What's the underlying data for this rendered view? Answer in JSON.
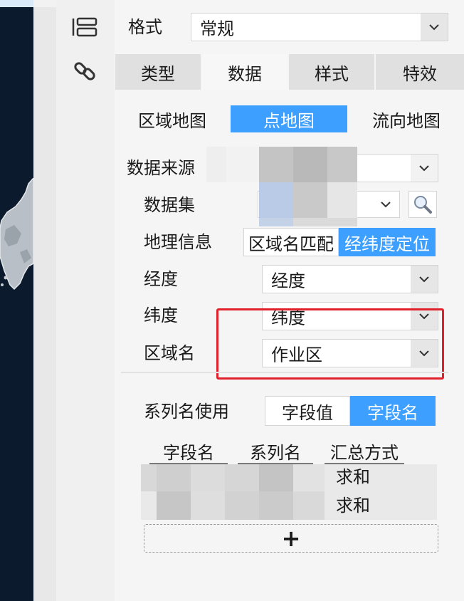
{
  "colors": {
    "accent": "#3d9fff",
    "highlight_box": "#e0212b",
    "map_bg": "#0b1a2c",
    "panel_bg": "#f5f5f5"
  },
  "rail": {
    "icons": [
      "layout-icon",
      "link-icon"
    ]
  },
  "format": {
    "label": "格式",
    "value": "常规"
  },
  "tabs": [
    {
      "label": "类型",
      "active": false
    },
    {
      "label": "数据",
      "active": true
    },
    {
      "label": "样式",
      "active": false
    },
    {
      "label": "特效",
      "active": false
    }
  ],
  "map_types": [
    {
      "label": "区域地图",
      "active": false
    },
    {
      "label": "点地图",
      "active": true
    },
    {
      "label": "流向地图",
      "active": false
    }
  ],
  "data_source": {
    "label": "数据来源"
  },
  "dataset": {
    "label": "数据集"
  },
  "geo_info": {
    "label": "地理信息",
    "options": [
      {
        "label": "区域名匹配",
        "active": false
      },
      {
        "label": "经纬度定位",
        "active": true
      }
    ]
  },
  "longitude": {
    "label": "经度",
    "value": "经度"
  },
  "latitude": {
    "label": "纬度",
    "value": "纬度"
  },
  "region_name": {
    "label": "区域名",
    "value": "作业区"
  },
  "series_name_use": {
    "label": "系列名使用",
    "options": [
      {
        "label": "字段值",
        "active": false
      },
      {
        "label": "字段名",
        "active": true
      }
    ]
  },
  "field_table": {
    "columns": [
      "字段名",
      "系列名",
      "汇总方式"
    ],
    "rows": [
      {
        "agg": "求和"
      },
      {
        "agg": "求和"
      }
    ],
    "add_label": "+"
  }
}
